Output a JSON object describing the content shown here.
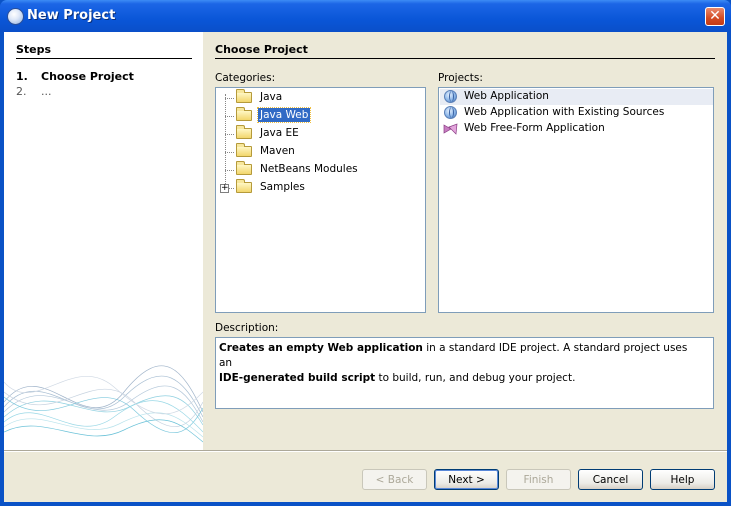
{
  "window": {
    "title": "New Project",
    "close_glyph": "✕"
  },
  "steps": {
    "title": "Steps",
    "items": [
      {
        "num": "1.",
        "label": "Choose Project"
      },
      {
        "num": "2.",
        "label": "..."
      }
    ]
  },
  "content": {
    "title": "Choose Project",
    "categories_label": "Categories:",
    "projects_label": "Projects:",
    "description_label": "Description:"
  },
  "categories": [
    {
      "label": "Java",
      "selected": false
    },
    {
      "label": "Java Web",
      "selected": true
    },
    {
      "label": "Java EE",
      "selected": false
    },
    {
      "label": "Maven",
      "selected": false
    },
    {
      "label": "NetBeans Modules",
      "selected": false
    },
    {
      "label": "Samples",
      "selected": false,
      "expander": "+"
    }
  ],
  "projects": [
    {
      "label": "Web Application",
      "icon": "globe-icon",
      "selected": true
    },
    {
      "label": "Web Application with Existing Sources",
      "icon": "globe-icon",
      "selected": false
    },
    {
      "label": "Web Free-Form Application",
      "icon": "freeform-project-icon",
      "selected": false
    }
  ],
  "description": {
    "bold1": "Creates an empty Web application",
    "text1": " in a standard IDE project. A standard project uses an ",
    "bold2": "IDE-generated build script",
    "text2": " to build, run, and debug your project."
  },
  "buttons": {
    "back": "< Back",
    "next": "Next >",
    "finish": "Finish",
    "cancel": "Cancel",
    "help": "Help"
  },
  "colors": {
    "titlebar": "#0a56d8",
    "selection": "#316ac5",
    "dialog_bg": "#ece9d8"
  }
}
